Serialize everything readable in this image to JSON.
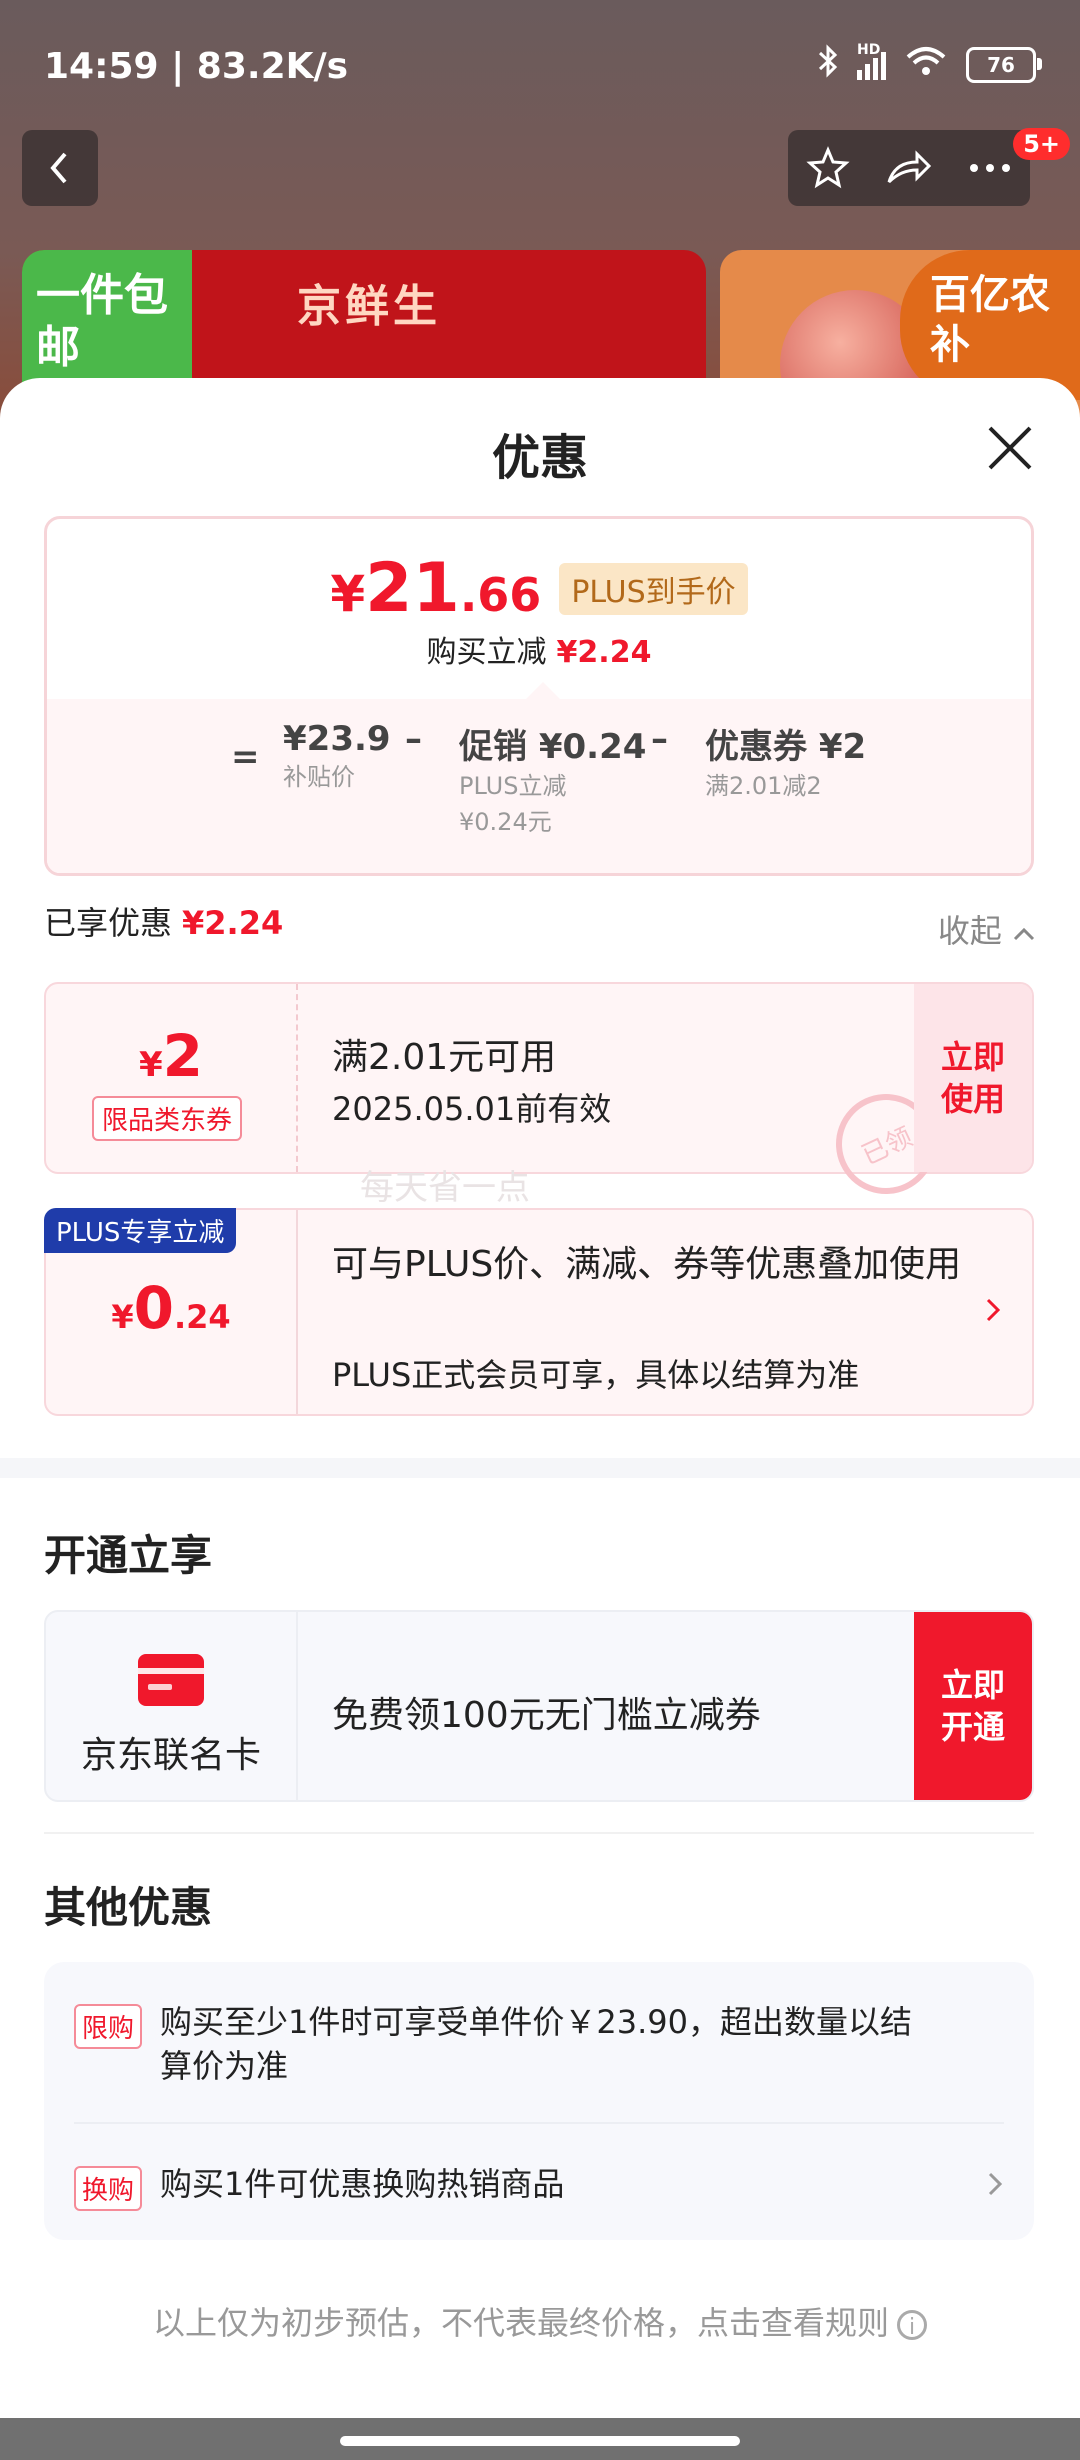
{
  "status": {
    "time_speed": "14:59 | 83.2K/s",
    "net": "HD",
    "battery": "76"
  },
  "header": {
    "badge": "5+"
  },
  "banners": {
    "b1_left": "一件包邮",
    "b1_text": "京鲜生",
    "b2_tag": "百亿农补"
  },
  "sheet": {
    "title": "优惠"
  },
  "price": {
    "currency": "¥",
    "int": "21",
    "dec": ".66",
    "plus_tag": "PLUS到手价",
    "reduce_label": "购买立减",
    "reduce_value": "¥2.24",
    "eq": "=",
    "base_value": "¥23.9",
    "base_label": "补贴价",
    "minus": "–",
    "promo_title": "促销 ¥0.24",
    "promo_sub1": "PLUS立减",
    "promo_sub2": "¥0.24元",
    "coupon_title": "优惠券 ¥2",
    "coupon_sub": "满2.01减2"
  },
  "enjoyed": {
    "label": "已享优惠",
    "value": "¥2.24",
    "collapse": "收起"
  },
  "coupon": {
    "currency": "¥",
    "amount": "2",
    "type": "限品类东券",
    "line1": "满2.01元可用",
    "line2": "2025.05.01前有效",
    "action": "立即使用",
    "stamp": "已领",
    "watermark": "每天省一点"
  },
  "plus": {
    "tag": "PLUS专享立减",
    "currency": "¥",
    "int": "0",
    "dec": ".24",
    "line1": "可与PLUS价、满减、券等优惠叠加使用",
    "line2": "PLUS正式会员可享，具体以结算为准"
  },
  "open_section": {
    "title": "开通立享",
    "card_name": "京东联名卡",
    "offer": "免费领100元无门槛立减券",
    "action": "立即开通"
  },
  "other_section": {
    "title": "其他优惠",
    "items": [
      {
        "tag": "限购",
        "text": "购买至少1件时可享受单件价￥23.90，超出数量以结算价为准"
      },
      {
        "tag": "换购",
        "text": "购买1件可优惠换购热销商品"
      }
    ]
  },
  "footer": {
    "text": "以上仅为初步预估，不代表最终价格，点击查看规则",
    "info": "i"
  },
  "colors": {
    "accent": "#f0182c",
    "plus_blue": "#1f3caa",
    "plus_gold": "#b2691a"
  }
}
